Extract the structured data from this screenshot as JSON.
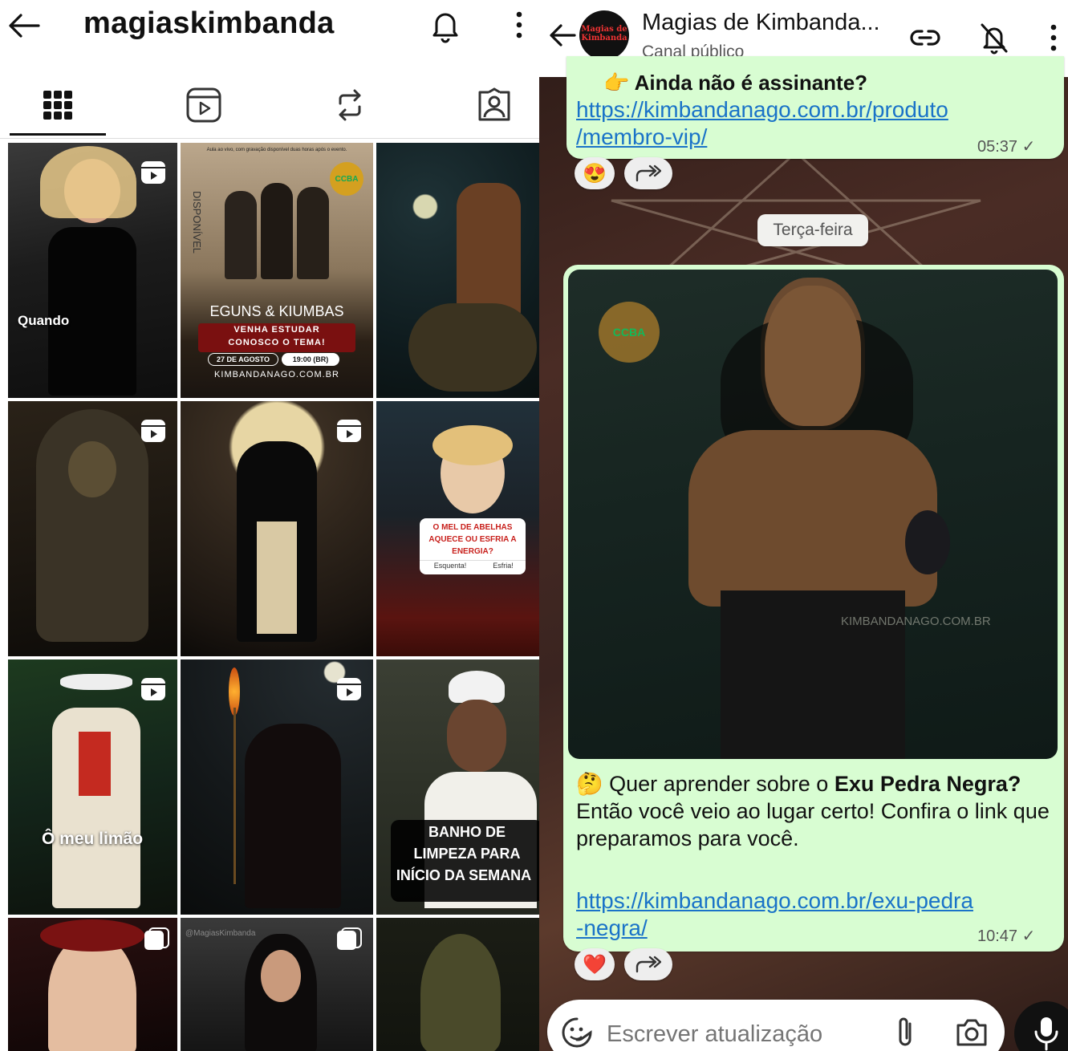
{
  "instagram": {
    "username": "magiaskimbanda",
    "icons": {
      "back": "arrow-left-icon",
      "notifications": "bell-icon",
      "more": "more-vertical-icon"
    },
    "tabs": [
      {
        "name": "grid",
        "icon": "grid-icon",
        "selected": true
      },
      {
        "name": "reels",
        "icon": "reels-icon",
        "selected": false
      },
      {
        "name": "reposts",
        "icon": "repost-icon",
        "selected": false
      },
      {
        "name": "tagged",
        "icon": "tagged-person-icon",
        "selected": false
      }
    ],
    "posts": [
      {
        "caption": "Quando",
        "reel": true
      },
      {
        "header_text": "Aula ao vivo, com gravação disponível duas horas após o evento.",
        "vertical_text": "DISPONÍVEL",
        "title": "EGUNS & KIUMBAS",
        "subtitle_1": "VENHA ESTUDAR",
        "subtitle_2": "CONOSCO O TEMA!",
        "date": "27 DE AGOSTO",
        "time": "19:00 (BR)",
        "site": "KIMBANDANAGO.COM.BR",
        "logo": "CCBA",
        "reel": false
      },
      {
        "caption": "",
        "reel": false
      },
      {
        "caption": "",
        "reel": true
      },
      {
        "caption": "",
        "reel": true
      },
      {
        "poll_question": "O MEL DE ABELHAS AQUECE OU ESFRIA A ENERGIA?",
        "poll_options": [
          "Esquenta!",
          "Esfria!"
        ],
        "reel": false
      },
      {
        "caption": "Ô meu limão",
        "reel": true
      },
      {
        "caption": "",
        "reel": true
      },
      {
        "caption_lines": [
          "BANHO DE",
          "LIMPEZA PARA",
          "INÍCIO DA SEMANA"
        ],
        "reel": false
      },
      {
        "caption": "",
        "reel": false
      },
      {
        "watermark": "@MagiasKimbanda",
        "reel": false
      },
      {
        "caption": "",
        "reel": false
      }
    ]
  },
  "whatsapp": {
    "channel_name": "Magias de Kimbanda...",
    "channel_type": "Canal público",
    "avatar_text": "Magias de Kimbanda",
    "icons": {
      "back": "arrow-left-icon",
      "link": "link-icon",
      "mute": "bell-off-icon",
      "more": "more-vertical-icon"
    },
    "messages": [
      {
        "partial_text": "👉 Ainda não é assinante?",
        "link_lines": [
          "https://kimbandanago.com.br/produto",
          "/membro-vip/"
        ],
        "time": "05:37",
        "reaction": "😍"
      },
      {
        "day_separator": "Terça-feira"
      },
      {
        "image_watermark": "KIMBANDANAGO.COM.BR",
        "image_logo": "CCBA",
        "emoji": "🤔",
        "text_prefix": "Quer aprender sobre o ",
        "text_bold": "Exu Pedra Negra?",
        "text_body": "Então você veio ao lugar certo! Confira o link que preparamos para você.",
        "link_lines": [
          "https://kimbandanago.com.br/exu-pedra",
          "-negra/"
        ],
        "time": "10:47",
        "reaction": "❤️"
      }
    ],
    "composer": {
      "placeholder": "Escrever atualização",
      "icons": [
        "sticker-icon",
        "attach-icon",
        "camera-icon",
        "mic-icon"
      ]
    }
  }
}
